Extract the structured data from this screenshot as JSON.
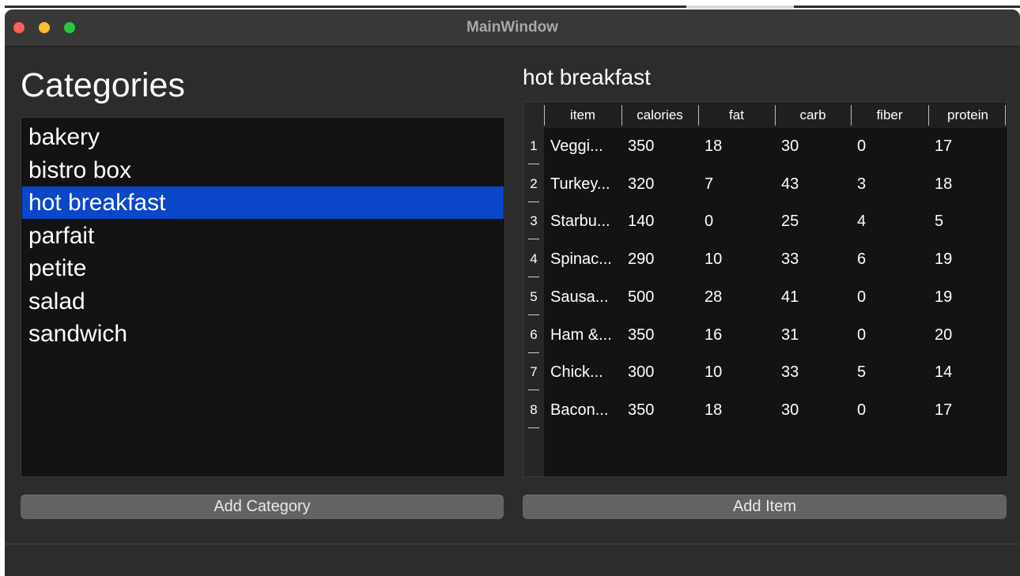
{
  "window": {
    "title": "MainWindow"
  },
  "categories": {
    "title": "Categories",
    "items": [
      "bakery",
      "bistro box",
      "hot breakfast",
      "parfait",
      "petite",
      "salad",
      "sandwich"
    ],
    "selected": "hot breakfast",
    "add_button": "Add Category"
  },
  "table": {
    "title": "hot breakfast",
    "columns": [
      "item",
      "calories",
      "fat",
      "carb",
      "fiber",
      "protein"
    ],
    "rows": [
      [
        "1",
        "Veggi...",
        "350",
        "18",
        "30",
        "0",
        "17"
      ],
      [
        "2",
        "Turkey...",
        "320",
        "7",
        "43",
        "3",
        "18"
      ],
      [
        "3",
        "Starbu...",
        "140",
        "0",
        "25",
        "4",
        "5"
      ],
      [
        "4",
        "Spinac...",
        "290",
        "10",
        "33",
        "6",
        "19"
      ],
      [
        "5",
        "Sausa...",
        "500",
        "28",
        "41",
        "0",
        "19"
      ],
      [
        "6",
        "Ham &...",
        "350",
        "16",
        "31",
        "0",
        "20"
      ],
      [
        "7",
        "Chick...",
        "300",
        "10",
        "33",
        "5",
        "14"
      ],
      [
        "8",
        "Bacon...",
        "350",
        "18",
        "30",
        "0",
        "17"
      ]
    ],
    "add_button": "Add Item"
  },
  "colors": {
    "selection": "#0a47c9",
    "window_bg": "#2c2c2c",
    "list_bg": "#131313",
    "button_bg": "#636363",
    "traffic_red": "#fe5f57",
    "traffic_yellow": "#febc2e",
    "traffic_green": "#28c840"
  }
}
